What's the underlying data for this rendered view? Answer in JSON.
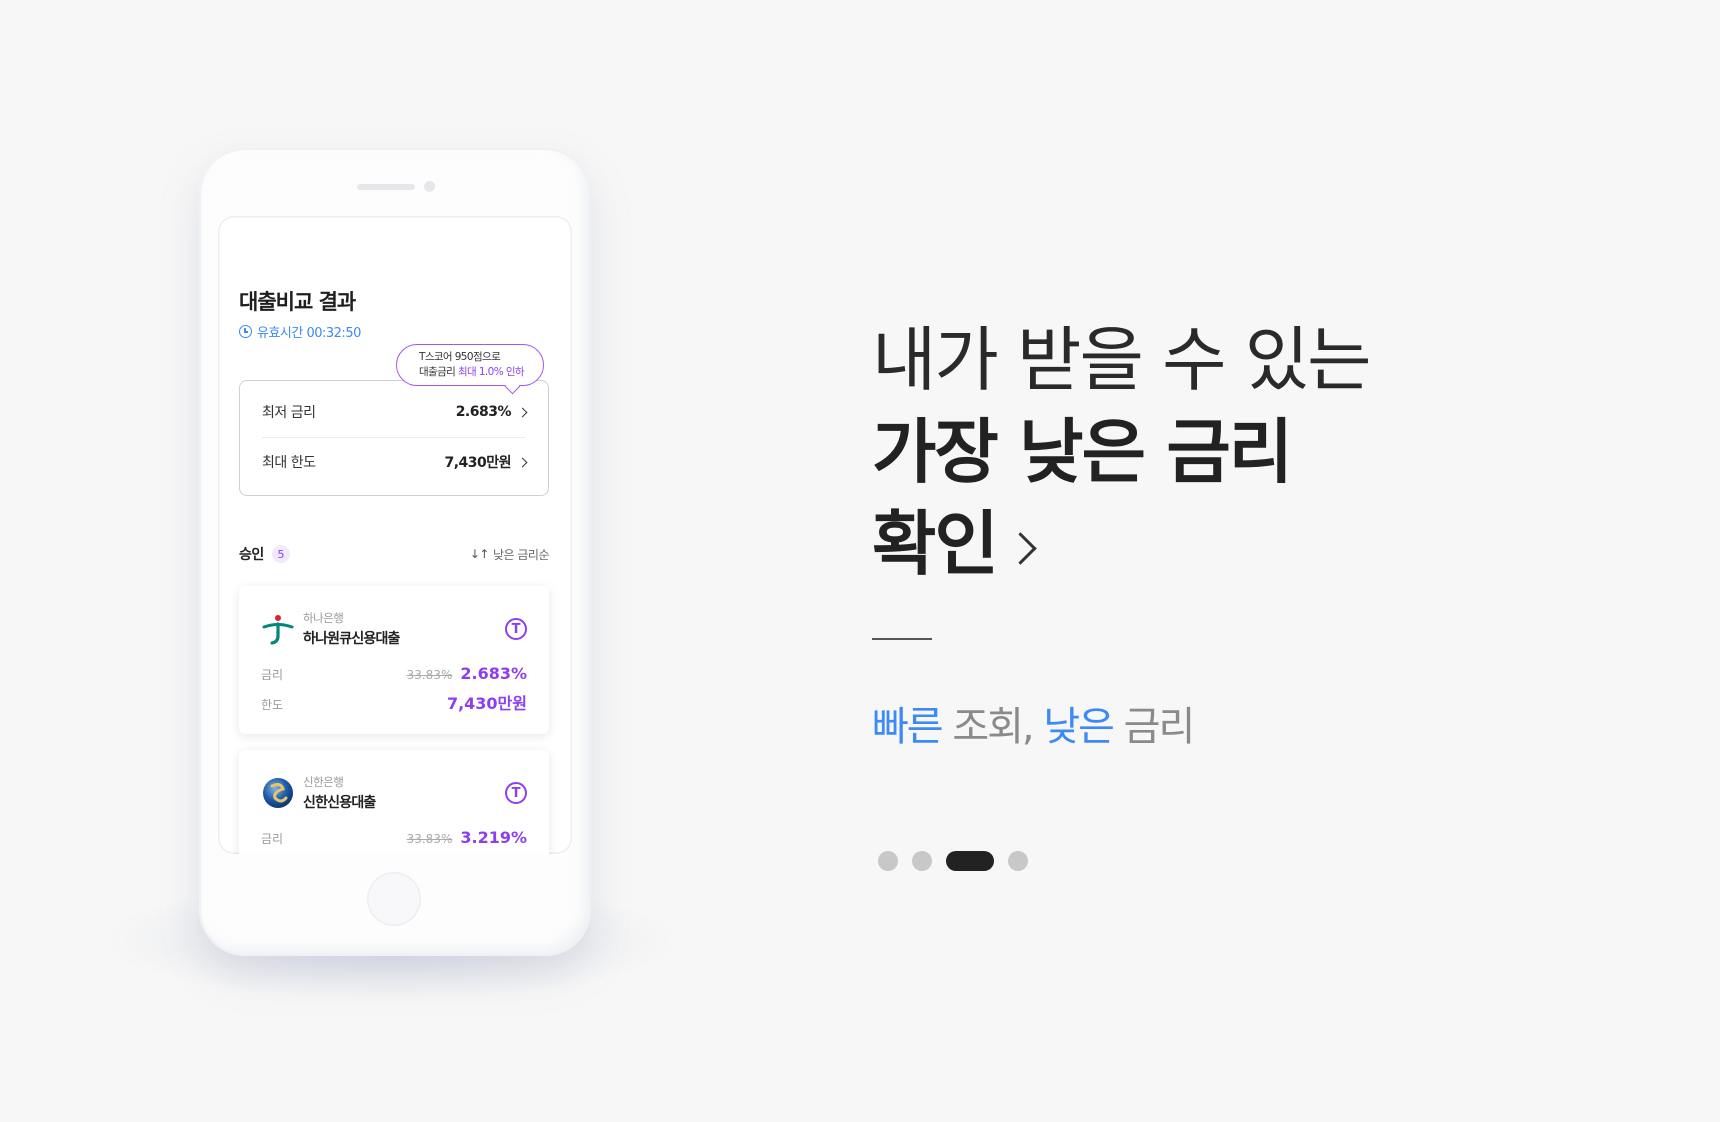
{
  "phone": {
    "screen": {
      "title": "대출비교 결과",
      "valid_time": "유효시간 00:32:50",
      "tooltip": {
        "line1": "T스코어 950점으로",
        "line2_prefix": "대출금리 ",
        "line2_highlight": "최대 1.0% 인하"
      },
      "summary": {
        "min_rate_label": "최저 금리",
        "min_rate_value": "2.683%",
        "max_limit_label": "최대 한도",
        "max_limit_value": "7,430만원"
      },
      "approved": {
        "label": "승인",
        "count": "5",
        "sort_label": "낮은 금리순",
        "sort_icon": "↓↑"
      },
      "loans": [
        {
          "bank": "하나은행",
          "product": "하나원큐신용대출",
          "badge": "T",
          "rate_label": "금리",
          "old_rate": "33.83%",
          "rate": "2.683%",
          "limit_label": "한도",
          "limit": "7,430만원"
        },
        {
          "bank": "신한은행",
          "product": "신한신용대출",
          "badge": "T",
          "rate_label": "금리",
          "old_rate": "33.83%",
          "rate": "3.219%"
        }
      ]
    }
  },
  "headline": {
    "line1": "내가 받을 수 있는",
    "line2": "가장 낮은 금리",
    "line3": "확인"
  },
  "tagline": {
    "part1": "빠른",
    "part2": " 조회, ",
    "part3": "낮은",
    "part4": " 금리"
  },
  "pager": {
    "total_pages": 4,
    "active_page": 3
  },
  "colors": {
    "accent_purple": "#8d3ff0",
    "accent_blue": "#3d8af7",
    "dark": "#222222"
  }
}
